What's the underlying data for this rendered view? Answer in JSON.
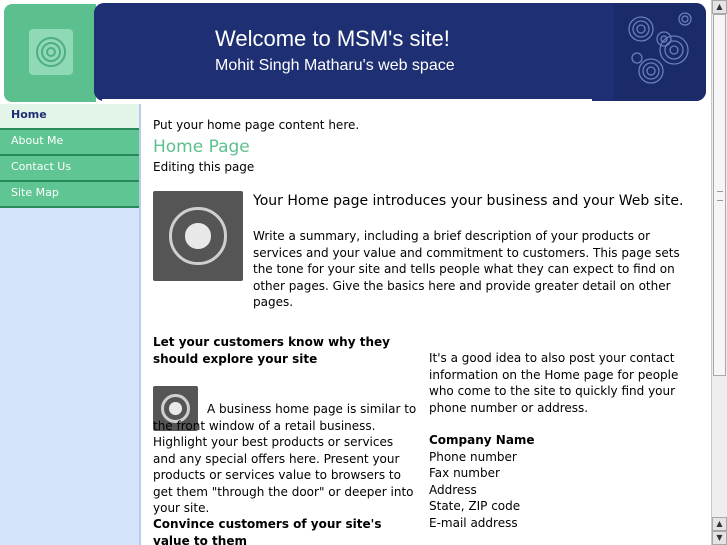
{
  "header": {
    "title": "Welcome to MSM's site!",
    "subtitle": "Mohit Singh Matharu's web space",
    "logo_icon": "concentric-circles-icon",
    "colors": {
      "banner": "#1f2f73",
      "accent": "#5cc08e"
    }
  },
  "sidebar": {
    "items": [
      {
        "label": "Home",
        "active": true
      },
      {
        "label": "About Me"
      },
      {
        "label": "Contact Us"
      },
      {
        "label": "Site Map"
      }
    ]
  },
  "main": {
    "placeholder_text": "Put your home page content here.",
    "heading": "Home Page",
    "editing_text": "Editing this page",
    "intro_title": "Your Home page introduces your business and your Web site.",
    "intro_body": "Write a summary, including a brief description of your products or services and your value and commitment to customers. This page sets the tone for your site and tells people what they can expect to find on other pages. Give the basics here and provide greater detail on other pages.",
    "left": {
      "heading1": "Let your customers know why they should explore your site",
      "para1": "A business home page is similar to the front window of a retail business. Highlight your best products or services and any special offers here. Present your products or services value to browsers to get them \"through the door\" or deeper into your site.",
      "heading2": "Convince customers of your site's value to them"
    },
    "right": {
      "contact_para": "It's a good idea to also post your contact information on the Home page for people who come to the site to quickly find your phone number or address.",
      "company_name": "Company Name",
      "lines": [
        "Phone number",
        "Fax number",
        "Address",
        "State, ZIP code",
        "E-mail address"
      ]
    }
  }
}
